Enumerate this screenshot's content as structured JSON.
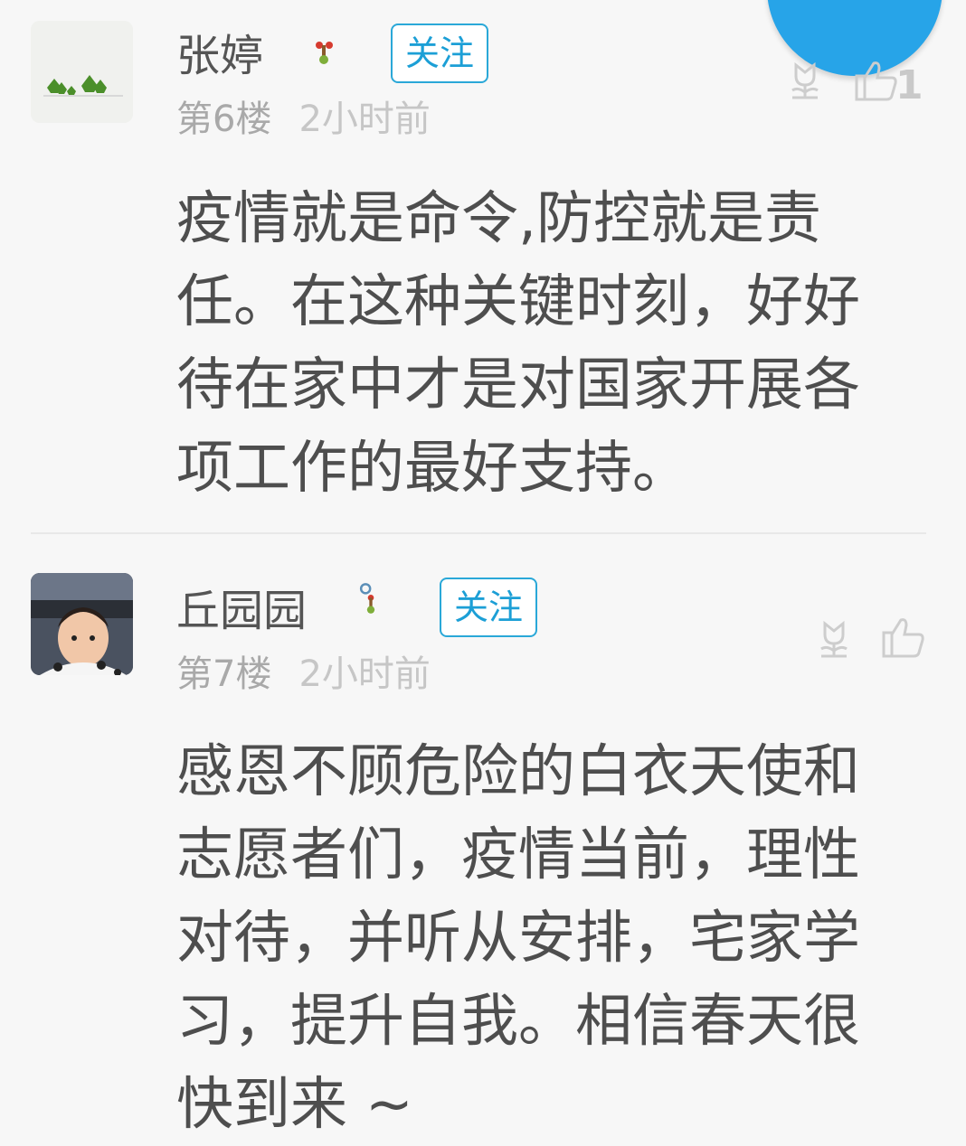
{
  "comments": [
    {
      "username": "张婷",
      "follow_label": "关注",
      "floor": "第6楼",
      "time": "2小时前",
      "text": "疫情就是命令,防控就是责任。在这种关键时刻，好好待在家中才是对国家开展各项工作的最好支持。",
      "like_count": "1"
    },
    {
      "username": "丘园园",
      "follow_label": "关注",
      "floor": "第7楼",
      "time": "2小时前",
      "text": "感恩不顾危险的白衣天使和志愿者们，疫情当前，理性对待，并听从安排，宅家学习，提升自我。相信春天很快到来 ~",
      "like_count": ""
    }
  ],
  "colors": {
    "accent": "#1c9fd6",
    "fab": "#27a4e8",
    "background": "#f7f7f7"
  },
  "icons": [
    "flower-icon",
    "thumbs-up-icon",
    "medal-badge-icon"
  ]
}
